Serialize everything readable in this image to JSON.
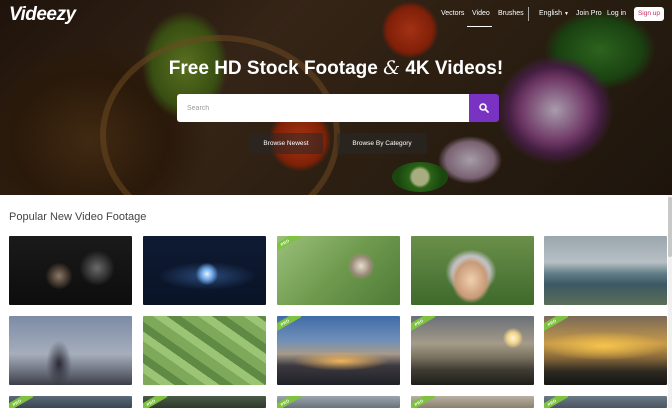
{
  "brand": {
    "logo": "Videezy"
  },
  "nav": {
    "links": [
      "Vectors",
      "Video",
      "Brushes"
    ],
    "active": "Video",
    "language": "English",
    "join_pro": "Join Pro",
    "login": "Log in",
    "signup": "Sign up"
  },
  "hero": {
    "headline_part1": "Free HD Stock Footage ",
    "headline_amp": "&",
    "headline_part2": " 4K Videos!",
    "search_placeholder": "Search",
    "browse_newest": "Browse Newest",
    "browse_category": "Browse By Category"
  },
  "section": {
    "title": "Popular New Video Footage"
  },
  "pro_label": "PRO",
  "thumbnails": [
    {
      "row": 1,
      "subject": "film reel projector",
      "pro": false
    },
    {
      "row": 1,
      "subject": "hands tablet glow",
      "pro": false
    },
    {
      "row": 1,
      "subject": "elderly woman outdoors",
      "pro": true
    },
    {
      "row": 1,
      "subject": "girl with headphones",
      "pro": false
    },
    {
      "row": 1,
      "subject": "coastal city bay",
      "pro": false
    },
    {
      "row": 2,
      "subject": "man with airplane model",
      "pro": false
    },
    {
      "row": 2,
      "subject": "aerial farm fields",
      "pro": false
    },
    {
      "row": 2,
      "subject": "city skyline dusk",
      "pro": true
    },
    {
      "row": 2,
      "subject": "sunset over river",
      "pro": true
    },
    {
      "row": 2,
      "subject": "golden sky landscape",
      "pro": true
    },
    {
      "row": 3,
      "subject": "row 3 thumbnail",
      "pro": true
    },
    {
      "row": 3,
      "subject": "row 3 thumbnail",
      "pro": true
    },
    {
      "row": 3,
      "subject": "row 3 thumbnail",
      "pro": true
    },
    {
      "row": 3,
      "subject": "row 3 thumbnail",
      "pro": true
    },
    {
      "row": 3,
      "subject": "row 3 thumbnail",
      "pro": true
    }
  ],
  "colors": {
    "accent": "#7a32c2",
    "signup_text": "#c32a5c",
    "pro_badge": "#7fc241"
  }
}
